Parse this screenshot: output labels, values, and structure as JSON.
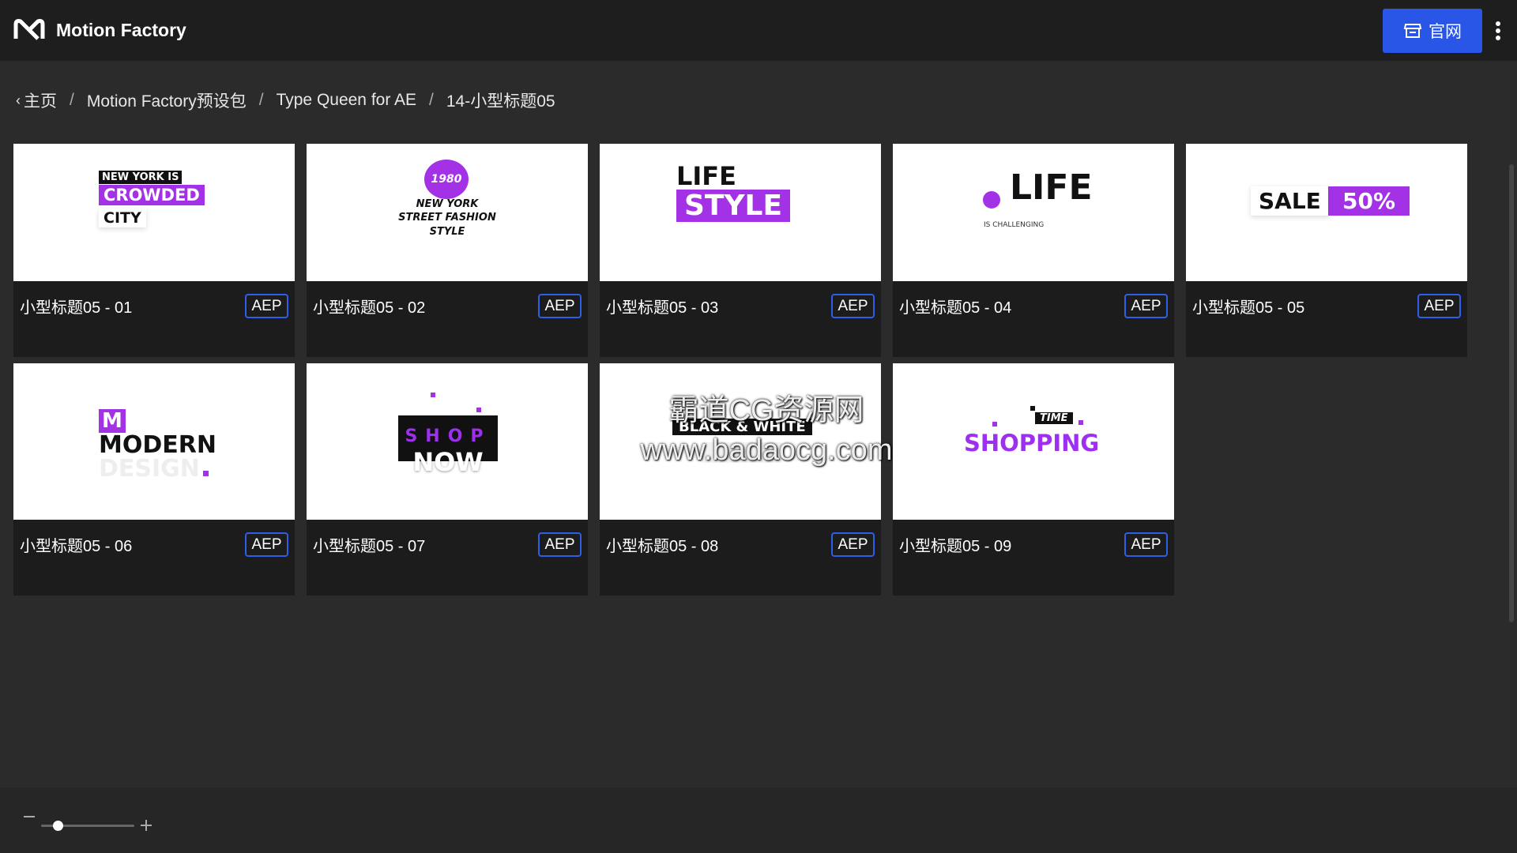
{
  "app": {
    "title": "Motion Factory",
    "logo_icon": "motion-factory-logo-icon"
  },
  "header": {
    "site_button_label": "官网",
    "site_button_icon": "store-icon",
    "more_icon": "more-vertical-icon",
    "accent_color": "#2a56e8"
  },
  "breadcrumb": {
    "items": [
      {
        "label": "主页"
      },
      {
        "label": "Motion Factory预设包"
      },
      {
        "label": "Type Queen for AE"
      },
      {
        "label": "14-小型标题05"
      }
    ],
    "separator": "/"
  },
  "cards": [
    {
      "name": "小型标题05 - 01",
      "badge": "AEP"
    },
    {
      "name": "小型标题05 - 02",
      "badge": "AEP"
    },
    {
      "name": "小型标题05 - 03",
      "badge": "AEP"
    },
    {
      "name": "小型标题05 - 04",
      "badge": "AEP"
    },
    {
      "name": "小型标题05 - 05",
      "badge": "AEP"
    },
    {
      "name": "小型标题05 - 06",
      "badge": "AEP"
    },
    {
      "name": "小型标题05 - 07",
      "badge": "AEP"
    },
    {
      "name": "小型标题05 - 08",
      "badge": "AEP"
    },
    {
      "name": "小型标题05 - 09",
      "badge": "AEP"
    }
  ],
  "thumbs": {
    "t1": {
      "line1": "NEW YORK IS",
      "line2": "CROWDED",
      "line3": "CITY"
    },
    "t2": {
      "year": "1980",
      "line1": "NEW YORK",
      "line2": "STREET FASHION",
      "line3": "STYLE"
    },
    "t3": {
      "line1": "LIFE",
      "line2": "STYLE"
    },
    "t4": {
      "line1": "LIFE",
      "line2": "IS CHALLENGING"
    },
    "t5": {
      "word": "SALE",
      "percent": "50%"
    },
    "t6": {
      "letter": "M",
      "line1": "MODERN",
      "line2": "DESIGN"
    },
    "t7": {
      "line1": "SHOP",
      "line2": "NOW"
    },
    "t8": {
      "line1": "BLACK & WHITE"
    },
    "t9": {
      "tag": "TIME",
      "line1": "SHOPPING"
    }
  },
  "watermark": {
    "line1": "霸道CG资源网",
    "line2": "www.badaocg.com"
  },
  "zoom": {
    "level": 0.18,
    "minus_icon": "zoom-out-icon",
    "plus_icon": "zoom-in-icon"
  },
  "colors": {
    "brand_purple": "#a331e6",
    "badge_border": "#2f5ee8"
  }
}
